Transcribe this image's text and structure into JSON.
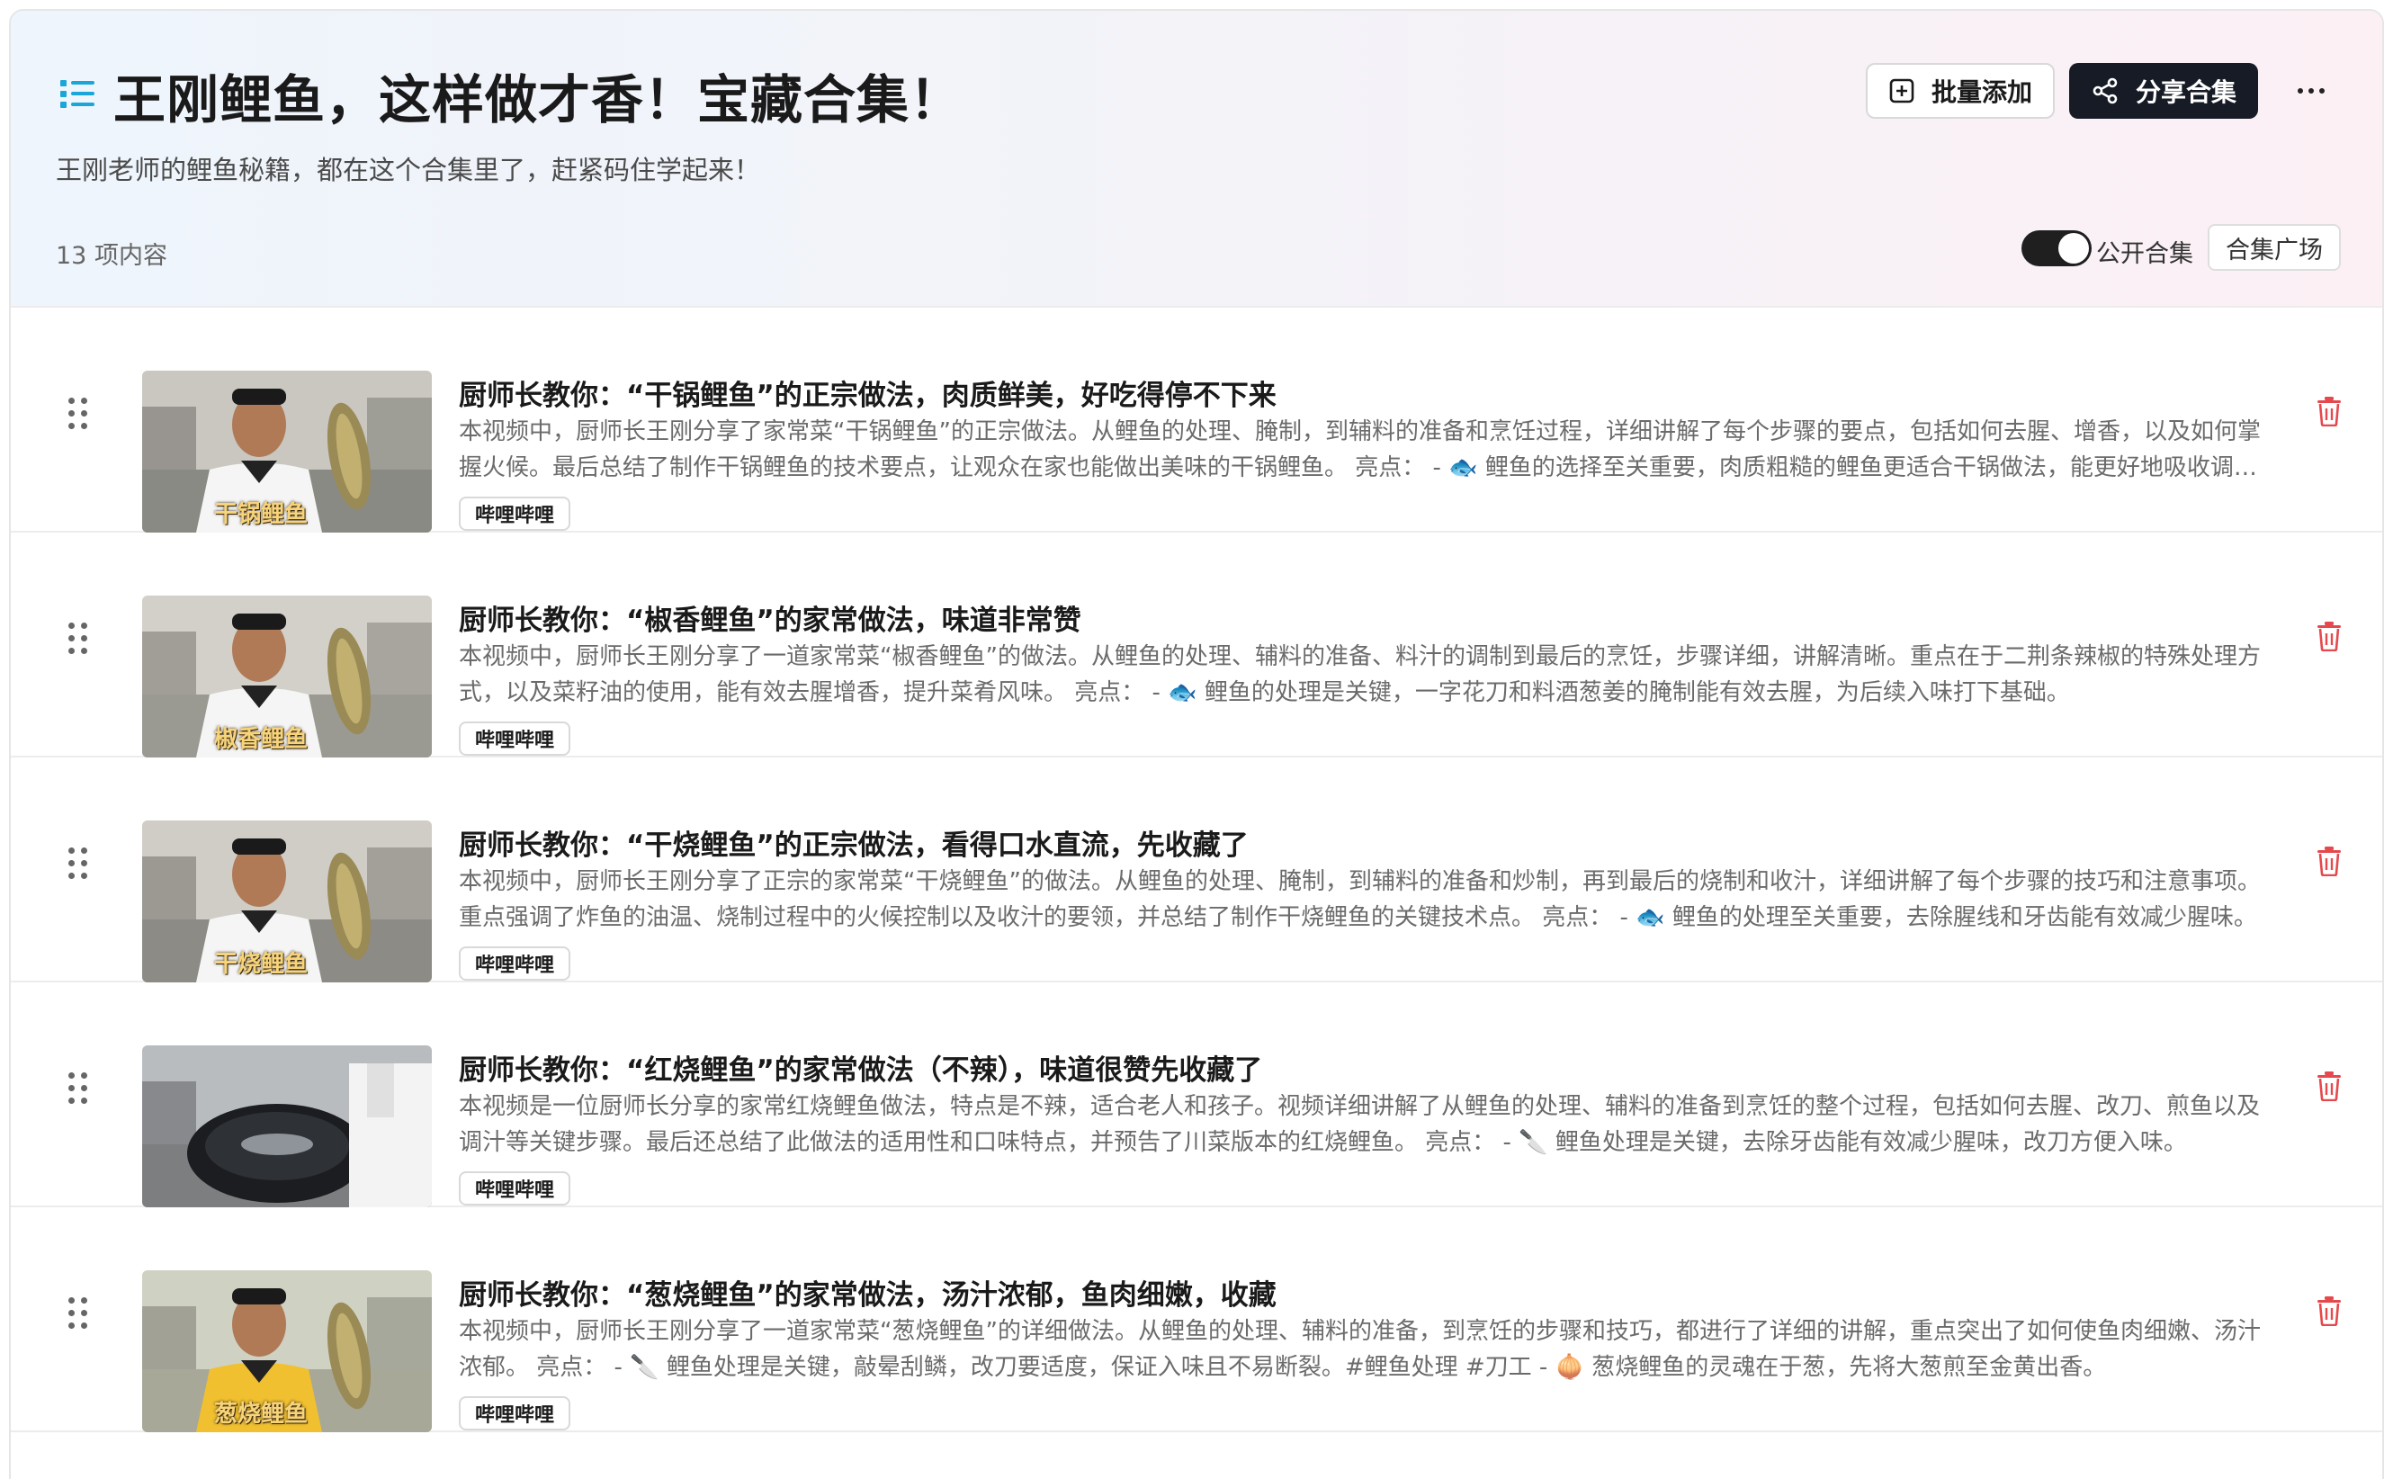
{
  "collection": {
    "title": "王刚鲤鱼，这样做才香！宝藏合集！",
    "subtitle": "王刚老师的鲤鱼秘籍，都在这个合集里了，赶紧码住学起来！",
    "count": "13 项内容"
  },
  "actions": {
    "batch_add": "批量添加",
    "share": "分享合集",
    "public_label": "公开合集",
    "public_on": true,
    "plaza": "合集广场"
  },
  "colors": {
    "accent": "#1aa6d9",
    "primary_button": "#161b26",
    "delete": "#e5484d"
  },
  "items": [
    {
      "title": "厨师长教你：“干锅鲤鱼”的正宗做法，肉质鲜美，好吃得停不下来",
      "desc": "本视频中，厨师长王刚分享了家常菜“干锅鲤鱼”的正宗做法。从鲤鱼的处理、腌制，到辅料的准备和烹饪过程，详细讲解了每个步骤的要点，包括如何去腥、增香，以及如何掌握火候。最后总结了制作干锅鲤鱼的技术要点，让观众在家也能做出美味的干锅鲤鱼。 亮点： - 🐟 鲤鱼的选择至关重要，肉质粗糙的鲤鱼更适合干锅做法，能更好地吸收调味汁的味道。",
      "tag": "哔哩哔哩",
      "thumb_caption": "干锅鲤鱼"
    },
    {
      "title": "厨师长教你：“椒香鲤鱼”的家常做法，味道非常赞",
      "desc": "本视频中，厨师长王刚分享了一道家常菜“椒香鲤鱼”的做法。从鲤鱼的处理、辅料的准备、料汁的调制到最后的烹饪，步骤详细，讲解清晰。重点在于二荆条辣椒的特殊处理方式，以及菜籽油的使用，能有效去腥增香，提升菜肴风味。 亮点： - 🐟 鲤鱼的处理是关键，一字花刀和料酒葱姜的腌制能有效去腥，为后续入味打下基础。",
      "tag": "哔哩哔哩",
      "thumb_caption": "椒香鲤鱼"
    },
    {
      "title": "厨师长教你：“干烧鲤鱼”的正宗做法，看得口水直流，先收藏了",
      "desc": "本视频中，厨师长王刚分享了正宗的家常菜“干烧鲤鱼”的做法。从鲤鱼的处理、腌制，到辅料的准备和炒制，再到最后的烧制和收汁，详细讲解了每个步骤的技巧和注意事项。重点强调了炸鱼的油温、烧制过程中的火候控制以及收汁的要领，并总结了制作干烧鲤鱼的关键技术点。 亮点： - 🐟 鲤鱼的处理至关重要，去除腥线和牙齿能有效减少腥味。",
      "tag": "哔哩哔哩",
      "thumb_caption": "干烧鲤鱼"
    },
    {
      "title": "厨师长教你：“红烧鲤鱼”的家常做法（不辣），味道很赞先收藏了",
      "desc": "本视频是一位厨师长分享的家常红烧鲤鱼做法，特点是不辣，适合老人和孩子。视频详细讲解了从鲤鱼的处理、辅料的准备到烹饪的整个过程，包括如何去腥、改刀、煎鱼以及调汁等关键步骤。最后还总结了此做法的适用性和口味特点，并预告了川菜版本的红烧鲤鱼。 亮点： - 🔪 鲤鱼处理是关键，去除牙齿能有效减少腥味，改刀方便入味。",
      "tag": "哔哩哔哩",
      "thumb_caption": ""
    },
    {
      "title": "厨师长教你：“葱烧鲤鱼”的家常做法，汤汁浓郁，鱼肉细嫩，收藏",
      "desc": "本视频中，厨师长王刚分享了一道家常菜“葱烧鲤鱼”的详细做法。从鲤鱼的处理、辅料的准备，到烹饪的步骤和技巧，都进行了详细的讲解，重点突出了如何使鱼肉细嫩、汤汁浓郁。 亮点： - 🔪 鲤鱼处理是关键，敲晕刮鳞，改刀要适度，保证入味且不易断裂。#鲤鱼处理 #刀工 - 🧅 葱烧鲤鱼的灵魂在于葱，先将大葱煎至金黄出香。",
      "tag": "哔哩哔哩",
      "thumb_caption": "葱烧鲤鱼"
    }
  ]
}
